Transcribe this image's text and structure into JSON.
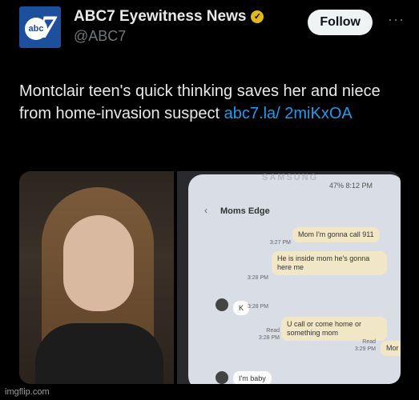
{
  "account": {
    "display_name": "ABC7 Eyewitness News",
    "handle": "@ABC7",
    "avatar_small": "abc",
    "avatar_large": "7"
  },
  "follow_label": "Follow",
  "more_label": "···",
  "tweet": {
    "text": "Montclair teen's quick thinking saves her and niece from home-invasion suspect ",
    "link": "abc7.la/ 2miKxOA"
  },
  "phone": {
    "brand": "SAMSUNG",
    "status": "47% 8:12 PM",
    "contact": "Moms Edge",
    "messages": [
      {
        "text": "Mom I'm gonna call 911",
        "time": "3:27 PM"
      },
      {
        "text": "He is inside mom he's gonna here me",
        "time": "3:28 PM"
      },
      {
        "text": "K",
        "time": "3:28 PM"
      },
      {
        "text": "U call or come home or something mom",
        "meta": "Read",
        "time": "3:28 PM"
      },
      {
        "text": "Mor",
        "meta": "Read",
        "time": "3:29 PM"
      },
      {
        "text": "I'm baby"
      }
    ]
  },
  "watermark": "imgflip.com"
}
